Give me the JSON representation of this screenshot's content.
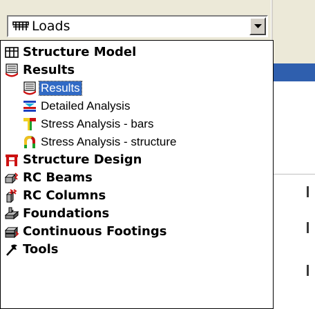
{
  "combo": {
    "selected_value": "Loads",
    "icon": "loads-grid-icon"
  },
  "dropdown": {
    "items": [
      {
        "label": "Structure Model",
        "icon": "structure-model-icon",
        "level": 0
      },
      {
        "label": "Results",
        "icon": "results-icon",
        "level": 0
      },
      {
        "label": "Results",
        "icon": "results-icon",
        "level": 1,
        "selected": true
      },
      {
        "label": "Detailed Analysis",
        "icon": "detailed-analysis-icon",
        "level": 1
      },
      {
        "label": "Stress Analysis - bars",
        "icon": "stress-bars-icon",
        "level": 1
      },
      {
        "label": "Stress Analysis - structure",
        "icon": "stress-structure-icon",
        "level": 1
      },
      {
        "label": "Structure Design",
        "icon": "structure-design-icon",
        "level": 0
      },
      {
        "label": "RC Beams",
        "icon": "rc-beams-icon",
        "level": 0
      },
      {
        "label": "RC Columns",
        "icon": "rc-columns-icon",
        "level": 0
      },
      {
        "label": "Foundations",
        "icon": "foundations-icon",
        "level": 0
      },
      {
        "label": "Continuous Footings",
        "icon": "continuous-footings-icon",
        "level": 0
      },
      {
        "label": "Tools",
        "icon": "tools-icon",
        "level": 0
      }
    ]
  },
  "colors": {
    "selection": "#316ac5",
    "brand_red": "#cc1111"
  }
}
